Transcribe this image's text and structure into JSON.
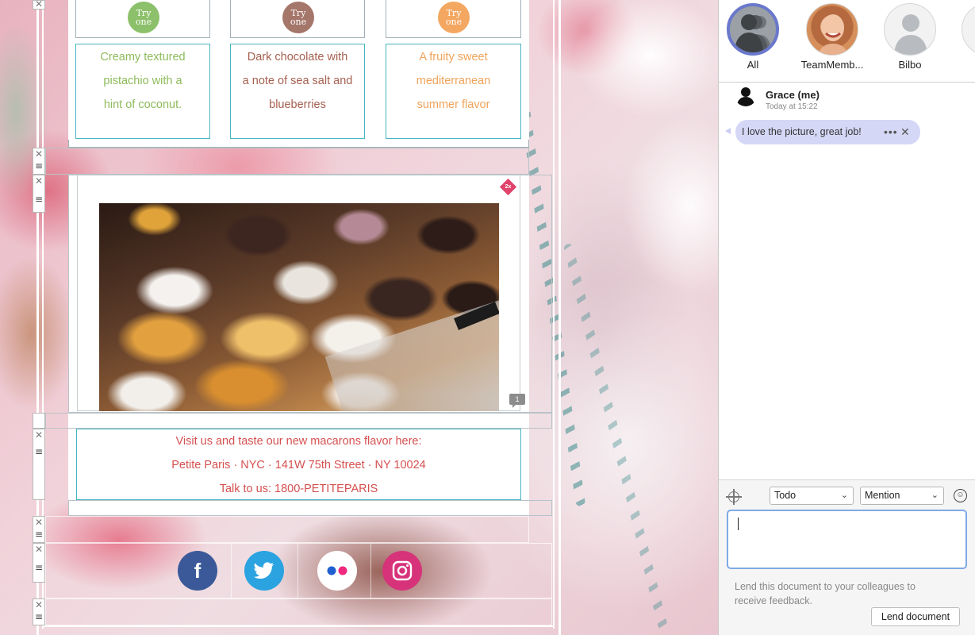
{
  "flavors": [
    {
      "try_label": "Try one",
      "description_lines": [
        "Creamy textured",
        "pistachio with a",
        "hint of coconut."
      ],
      "color": "#8dbb5a",
      "circle_color": "#8cc06a"
    },
    {
      "try_label": "Try one",
      "description_lines": [
        "Dark chocolate with",
        "a note of sea salt and",
        "blueberries"
      ],
      "color": "#a65f4f",
      "circle_color": "#a5766a"
    },
    {
      "try_label": "Try one",
      "description_lines": [
        "A fruity sweet",
        "mediterranean",
        "summer flavor"
      ],
      "color": "#f0a35a",
      "circle_color": "#f3a761"
    }
  ],
  "image_badge": "2x",
  "comment_count": "1",
  "contact": {
    "line1": "Visit us and taste our new macarons flavor here:",
    "line2": "Petite Paris · NYC · 141W 75th Street · NY 10024",
    "line3": "Talk to us: 1800-PETITEPARIS",
    "color": "#d55050"
  },
  "social": [
    {
      "name": "facebook",
      "glyph": "f",
      "color": "#3b5998"
    },
    {
      "name": "twitter",
      "glyph": "t",
      "color": "#2aa3e0"
    },
    {
      "name": "flickr",
      "glyph": "",
      "color": "#ffffff"
    },
    {
      "name": "instagram",
      "glyph": "◎",
      "color": "#d6337a"
    }
  ],
  "block_controls": {
    "close_glyph": "✕",
    "drag_glyph": "≡"
  },
  "sidebar": {
    "avatars": [
      {
        "name": "All",
        "selected": true
      },
      {
        "name": "TeamMemb...",
        "selected": false
      },
      {
        "name": "Bilbo",
        "selected": false
      }
    ],
    "message": {
      "author": "Grace (me)",
      "time": "Today at 15:22",
      "text": "I love the picture, great job!",
      "more_glyph": "•••",
      "close_glyph": "✕"
    },
    "composer": {
      "type_value": "Todo",
      "mention_value": "Mention",
      "hint": "Lend this document to your colleagues to receive feedback.",
      "lend_button": "Lend document",
      "emoji_glyph": "☺",
      "chevron": "⌄"
    },
    "accent_color": "#6a78cc",
    "bubble_color": "#d4d8f6"
  }
}
